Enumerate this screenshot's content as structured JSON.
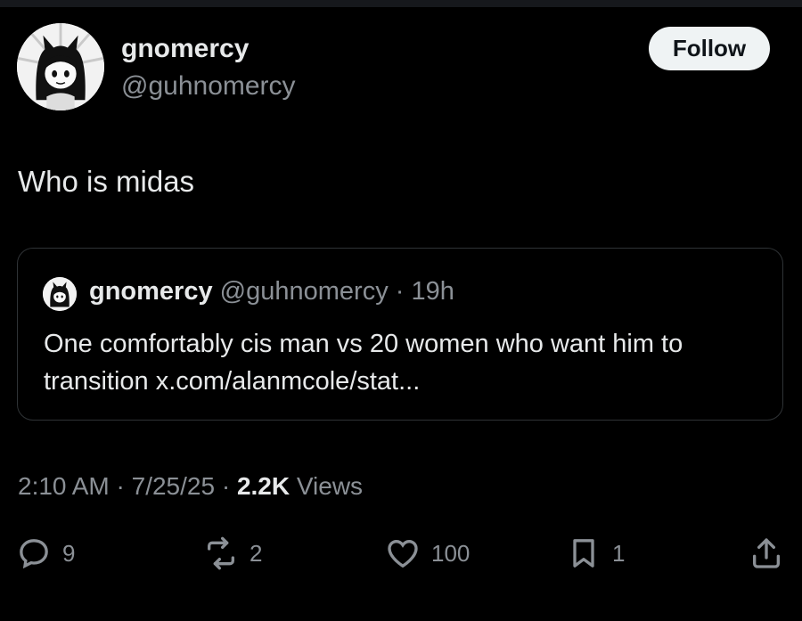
{
  "author": {
    "display_name": "gnomercy",
    "handle": "@guhnomercy"
  },
  "follow_label": "Follow",
  "tweet_text": "Who is midas",
  "quoted": {
    "display_name": "gnomercy",
    "handle": "@guhnomercy",
    "separator": "·",
    "age": "19h",
    "text": "One comfortably cis man vs 20 women who want him to transition x.com/alanmcole/stat..."
  },
  "meta": {
    "time": "2:10 AM",
    "sep1": "·",
    "date": "7/25/25",
    "sep2": "·",
    "views_count": "2.2K",
    "views_label": "Views"
  },
  "actions": {
    "replies": "9",
    "reposts": "2",
    "likes": "100",
    "bookmarks": "1"
  },
  "icons": {
    "reply": "reply-icon",
    "repost": "repost-icon",
    "like": "heart-icon",
    "bookmark": "bookmark-icon",
    "share": "share-icon"
  },
  "colors": {
    "background": "#000000",
    "text": "#e7e9ea",
    "muted": "#8b9096",
    "follow_bg": "#eff3f4"
  }
}
